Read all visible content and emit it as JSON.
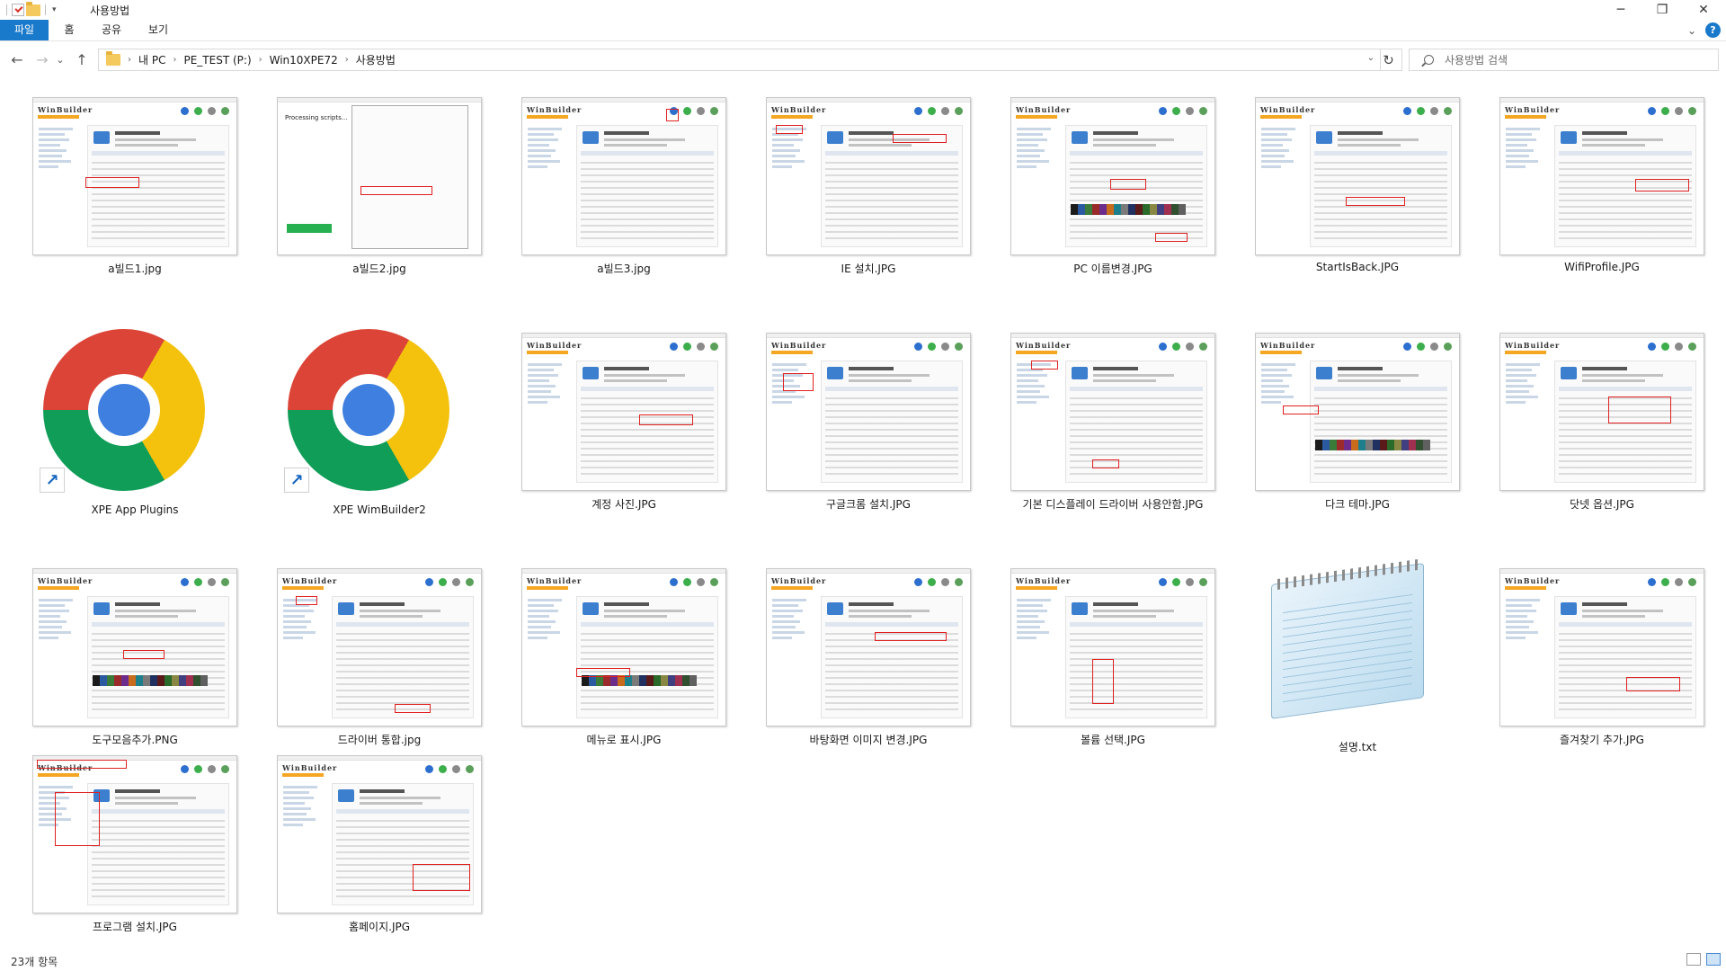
{
  "window": {
    "title": "사용방법",
    "qat_dropdown": "▾",
    "controls": {
      "minimize": "─",
      "maximize": "❐",
      "close": "✕"
    }
  },
  "ribbon": {
    "tabs": [
      {
        "label": "파일",
        "active": true
      },
      {
        "label": "홈"
      },
      {
        "label": "공유"
      },
      {
        "label": "보기"
      }
    ],
    "expand_glyph": "⌄",
    "help_glyph": "?"
  },
  "nav": {
    "back": "←",
    "forward": "→",
    "recent": "⌄",
    "up": "↑",
    "breadcrumb": [
      "내 PC",
      "PE_TEST (P:)",
      "Win10XPE72",
      "사용방법"
    ],
    "breadcrumb_sep": "›",
    "address_dropdown": "⌄",
    "refresh": "↻",
    "search_placeholder": "사용방법 검색"
  },
  "files": [
    {
      "name": "a빌드1.jpg",
      "kind": "screenshot"
    },
    {
      "name": "a빌드2.jpg",
      "kind": "dialog"
    },
    {
      "name": "a빌드3.jpg",
      "kind": "screenshot"
    },
    {
      "name": "IE 설치.JPG",
      "kind": "screenshot"
    },
    {
      "name": "PC 이름변경.JPG",
      "kind": "screenshot"
    },
    {
      "name": "StartIsBack.JPG",
      "kind": "screenshot"
    },
    {
      "name": "WifiProfile.JPG",
      "kind": "screenshot"
    },
    {
      "name": "XPE App Plugins",
      "kind": "chrome"
    },
    {
      "name": "XPE WimBuilder2",
      "kind": "chrome"
    },
    {
      "name": "계정 사진.JPG",
      "kind": "screenshot"
    },
    {
      "name": "구글크롬 설치.JPG",
      "kind": "screenshot"
    },
    {
      "name": "기본 디스플레이 드라이버 사용안함.JPG",
      "kind": "screenshot"
    },
    {
      "name": "다크 테마.JPG",
      "kind": "screenshot"
    },
    {
      "name": "닷넷 옵션.JPG",
      "kind": "screenshot"
    },
    {
      "name": "도구모음추가.PNG",
      "kind": "screenshot"
    },
    {
      "name": "드라이버 통합.jpg",
      "kind": "screenshot"
    },
    {
      "name": "메뉴로 표시.JPG",
      "kind": "screenshot"
    },
    {
      "name": "바탕화면 이미지 변경.JPG",
      "kind": "screenshot"
    },
    {
      "name": "볼륨 선택.JPG",
      "kind": "screenshot"
    },
    {
      "name": "설명.txt",
      "kind": "notepad"
    },
    {
      "name": "즐겨찾기 추가.JPG",
      "kind": "screenshot"
    },
    {
      "name": "프로그램 설치.JPG",
      "kind": "screenshot"
    },
    {
      "name": "홈페이지.JPG",
      "kind": "screenshot"
    }
  ],
  "thumb_text": {
    "winbuilder": "WinBuilder",
    "processing": "Processing scripts..."
  },
  "status": {
    "item_count": "23개 항목"
  },
  "colors": {
    "accent": "#1979ca",
    "highlight": "#e02020",
    "winbuilder_orange": "#f5a623"
  }
}
